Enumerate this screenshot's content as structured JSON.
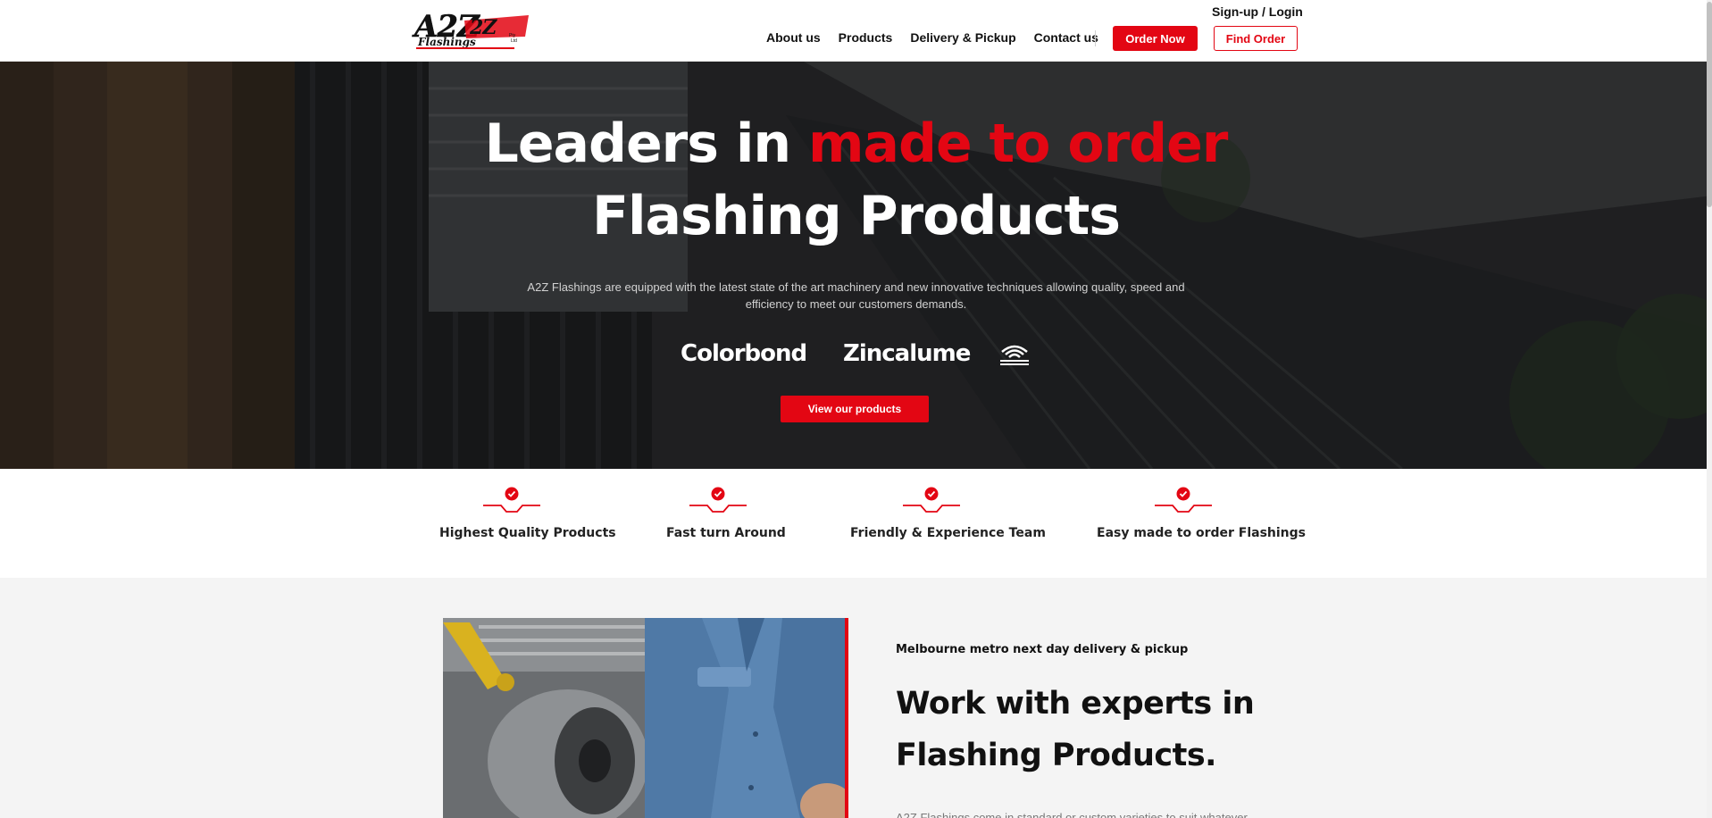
{
  "header": {
    "logo_text": "A2Z",
    "logo_sub": "Flashings",
    "logo_small": "Pty Ltd",
    "signup_label": "Sign-up / Login",
    "nav": [
      "About us",
      "Products",
      "Delivery & Pickup",
      "Contact us"
    ],
    "order_now_label": "Order Now",
    "find_order_label": "Find Order"
  },
  "hero": {
    "title_part1": "Leaders in ",
    "title_highlight": "made to order",
    "title_line2": "Flashing Products",
    "subtitle": "A2Z Flashings are equipped with the latest state of the art machinery and new innovative techniques allowing quality, speed and efficiency to meet our customers demands.",
    "brands": [
      "Colorbond",
      "Zincalume",
      "BlueScope Distribution"
    ],
    "cta_label": "View our products"
  },
  "features": [
    {
      "label": "Highest Quality Products"
    },
    {
      "label": "Fast turn Around"
    },
    {
      "label": "Friendly & Experience Team"
    },
    {
      "label": "Easy made to order Flashings"
    }
  ],
  "about": {
    "kicker": "Melbourne metro next day delivery & pickup",
    "title_line1": "Work with experts in",
    "title_line2": "Flashing Products.",
    "body": "A2Z Flashings come in standard or custom varieties to suit whatever"
  },
  "colors": {
    "accent": "#e30613",
    "hero_overlay": "#2b2b2b",
    "section_bg": "#f4f4f4"
  },
  "icons": [
    "check-circle-icon"
  ]
}
